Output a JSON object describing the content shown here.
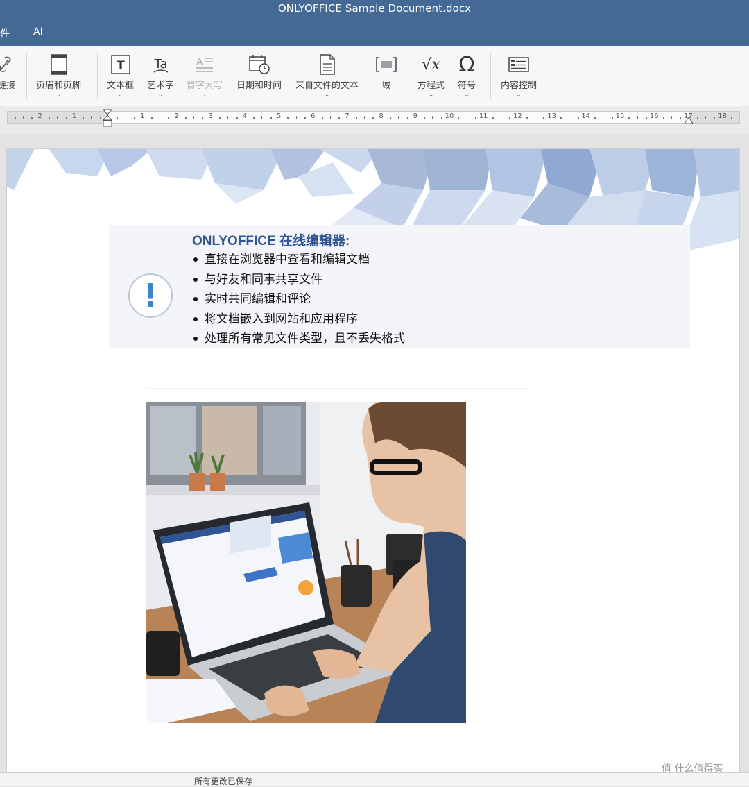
{
  "window": {
    "title": "ONLYOFFICE Sample Document.docx"
  },
  "menu_tabs": [
    "件",
    "AI"
  ],
  "toolbar": {
    "link_label": "链接",
    "header_footer_label": "页眉和页脚",
    "textbox_label": "文本框",
    "wordart_label": "艺术字",
    "dropcap_label": "首字大写",
    "datetime_label": "日期和时间",
    "from_file_label": "来自文件的文本",
    "field_label": "域",
    "equation_label": "方程式",
    "symbol_label": "符号",
    "content_control_label": "内容控制",
    "textbox_icon_text": "T",
    "wordart_icon_text": "Ta",
    "equation_icon_text": "√x",
    "symbol_icon_text": "Ω"
  },
  "ruler": {
    "labels": [
      "2",
      "1",
      "1",
      "2",
      "3",
      "4",
      "5",
      "6",
      "7",
      "8",
      "9",
      "10",
      "11",
      "12",
      "13",
      "14",
      "15",
      "16",
      "17",
      "18"
    ]
  },
  "document": {
    "callout_heading": "ONLYOFFICE 在线编辑器:",
    "callout_items": [
      "直接在浏览器中查看和编辑文档",
      "与好友和同事共享文件",
      "实时共同编辑和评论",
      "将文档嵌入到网站和应用程序",
      "处理所有常见文件类型，且不丢失格式"
    ],
    "warning_mark": "!"
  },
  "status": {
    "save_status": "所有更改已保存"
  },
  "watermark": {
    "text": "值 什么值得买"
  },
  "colors": {
    "titlebar": "#446995",
    "heading": "#2f5595",
    "warning": "#3a86c8"
  }
}
